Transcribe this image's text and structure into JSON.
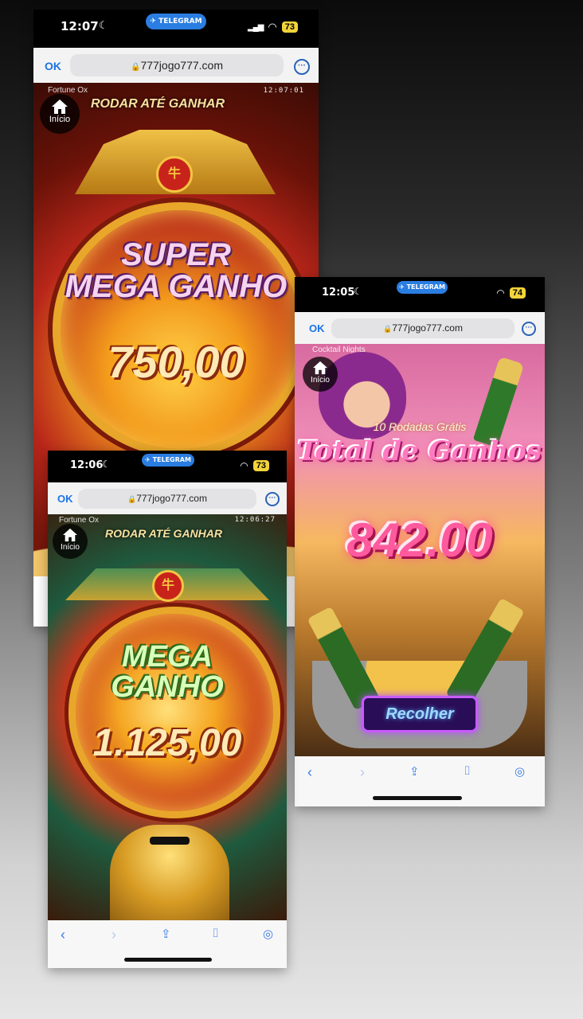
{
  "shot1": {
    "status": {
      "time": "12:07",
      "app_pill": "TELEGRAM",
      "battery": "73"
    },
    "url": {
      "ok": "OK",
      "domain": "777jogo777.com"
    },
    "game": {
      "name": "Fortune Ox",
      "clock": "12:07:01",
      "banner": "RODAR ATÉ GANHAR",
      "home_label": "Início",
      "title_line1": "SUPER",
      "title_line2": "MEGA GANHO",
      "amount": "750,00"
    }
  },
  "shot2": {
    "status": {
      "time": "12:06",
      "app_pill": "TELEGRAM",
      "battery": "73"
    },
    "url": {
      "ok": "OK",
      "domain": "777jogo777.com"
    },
    "game": {
      "name": "Fortune Ox",
      "clock": "12:06:27",
      "banner": "RODAR ATÉ GANHAR",
      "home_label": "Início",
      "title_line1": "MEGA",
      "title_line2": "GANHO",
      "amount": "1.125,00"
    }
  },
  "shot3": {
    "status": {
      "time": "12:05",
      "app_pill": "TELEGRAM",
      "battery": "74"
    },
    "url": {
      "ok": "OK",
      "domain": "777jogo777.com"
    },
    "game": {
      "name": "Cocktail Nights",
      "home_label": "Início",
      "free_spins": "10 Rodadas Grátis",
      "title": "Total de Ganhos",
      "amount": "842.00",
      "collect_button": "Recolher"
    }
  },
  "colors": {
    "gold": "#f5c542",
    "telegram_blue": "#2a7de1",
    "safari_blue": "#3b7de6",
    "pink_title": "#ff4fa8"
  }
}
